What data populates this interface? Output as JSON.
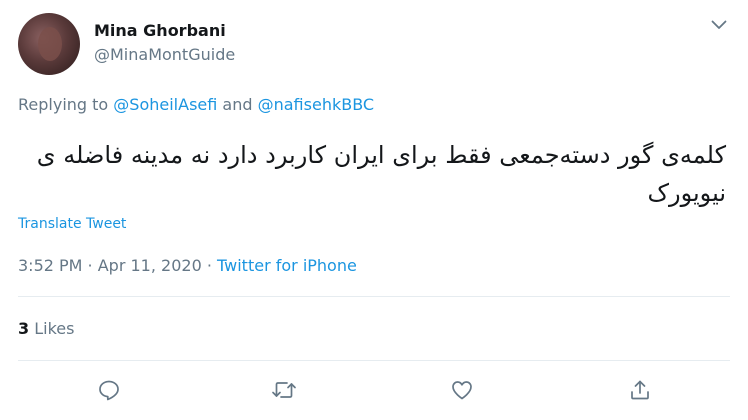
{
  "author": {
    "name": "Mina Ghorbani",
    "handle": "@MinaMontGuide"
  },
  "reply": {
    "prefix": "Replying to ",
    "user1": "@SoheilAsefi",
    "conjunction": " and ",
    "user2": "@nafisehkBBC"
  },
  "tweet": {
    "text": "کلمه‌ی گور دسته‌جمعی فقط برای ایران کاربرد دارد نه مدینه فاضله ی نیویورک"
  },
  "translate_label": "Translate Tweet",
  "meta": {
    "time": "3:52 PM",
    "separator1": " · ",
    "date": "Apr 11, 2020",
    "separator2": " · ",
    "source": "Twitter for iPhone"
  },
  "stats": {
    "likes_count": "3",
    "likes_label": " Likes"
  },
  "icons": {
    "caret": "chevron-down-icon",
    "reply": "reply-icon",
    "retweet": "retweet-icon",
    "like": "heart-icon",
    "share": "share-icon"
  },
  "colors": {
    "link": "#1b95e0",
    "secondary_text": "#657786",
    "primary_text": "#14171a",
    "divider": "#e6ecf0"
  }
}
